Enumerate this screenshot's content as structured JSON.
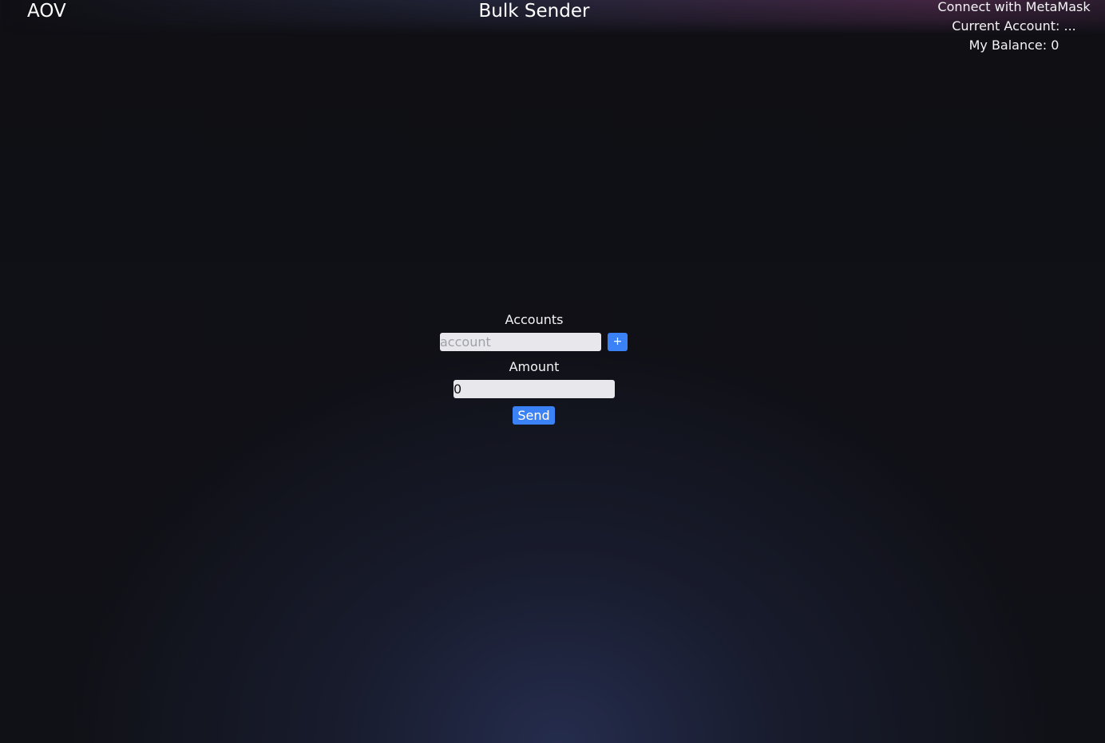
{
  "header": {
    "brand": "AOV",
    "title": "Bulk Sender"
  },
  "wallet": {
    "connect_label": "Connect with MetaMask",
    "current_account": "Current Account: ...",
    "balance": "My Balance: 0"
  },
  "form": {
    "accounts_label": "Accounts",
    "account_placeholder": "account",
    "add_label": "+",
    "amount_label": "Amount",
    "amount_value": "0",
    "send_label": "Send"
  },
  "colors": {
    "accent": "#3b82f6",
    "background": "#0f0f14",
    "input_bg": "#e8e8ec"
  }
}
